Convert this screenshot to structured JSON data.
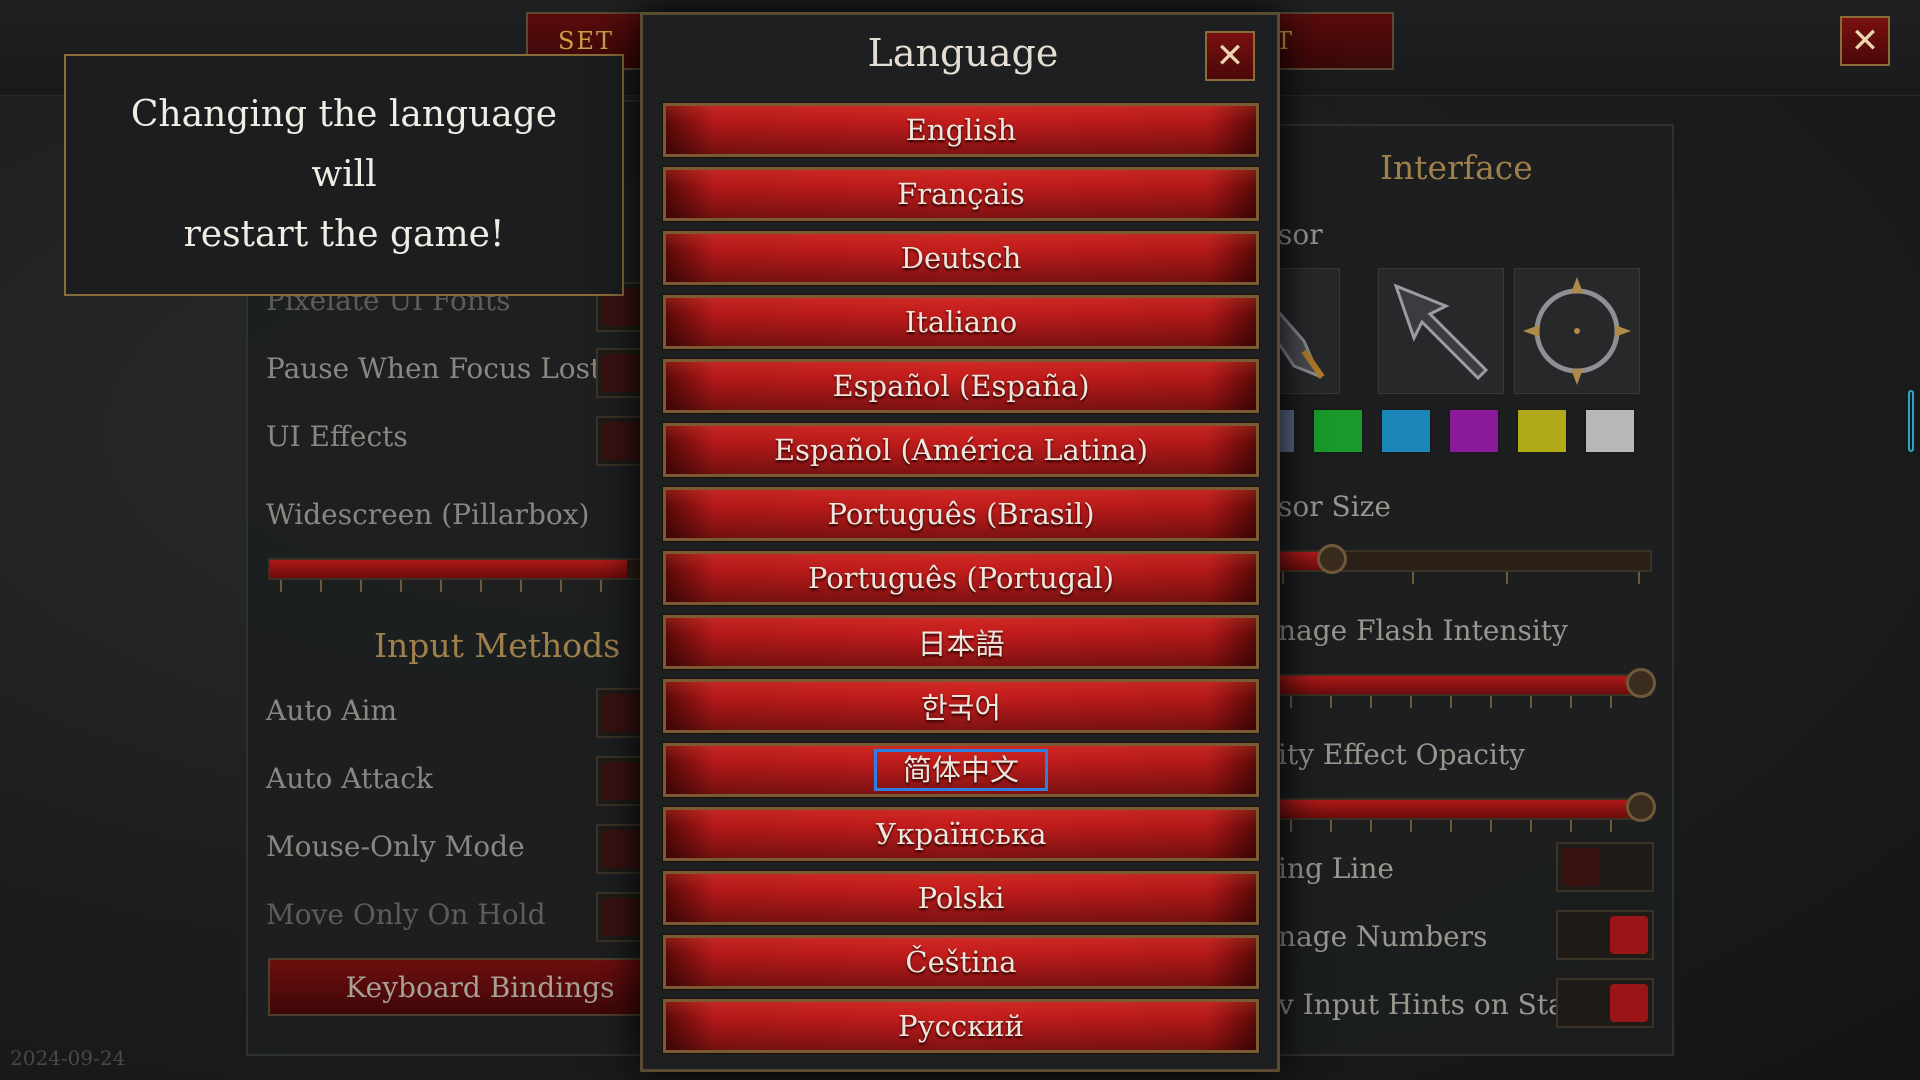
{
  "settings": {
    "tab_left_label": "SET",
    "tab_right_label": "T"
  },
  "notice": {
    "text_line1": "Changing the language will",
    "text_line2": "restart the game!"
  },
  "left_panel": {
    "items": [
      {
        "label": "Pixelate UI Fonts",
        "state": "off"
      },
      {
        "label": "Pause When Focus Lost",
        "state": "off"
      },
      {
        "label": "UI Effects",
        "state": "off"
      }
    ],
    "widescreen_label": "Widescreen (Pillarbox)",
    "widescreen_value": 0.95,
    "input_methods_heading": "Input Methods",
    "input_items": [
      {
        "label": "Auto Aim",
        "state": "off"
      },
      {
        "label": "Auto Attack",
        "state": "off"
      },
      {
        "label": "Mouse-Only Mode",
        "state": "off"
      },
      {
        "label": "Move Only On Hold",
        "state": "off"
      }
    ],
    "keyboard_bindings_label": "Keyboard Bindings"
  },
  "right_panel": {
    "heading": "Interface",
    "cursor_label": "sor",
    "cursor_size_label": "sor Size",
    "cursor_size_value": 0.2,
    "flash_label": "nage Flash Intensity",
    "flash_value": 1.0,
    "opacity_label": "ity Effect Opacity",
    "opacity_value": 1.0,
    "aiming_line_label": "ing Line",
    "aiming_line_state": "off",
    "damage_numbers_label": "nage Numbers",
    "damage_numbers_state": "on",
    "input_hints_label": "v Input Hints on Start",
    "input_hints_state": "on",
    "cursor_icons": [
      "gauntlet-cursor-icon",
      "arrow-cursor-icon",
      "crosshair-cursor-icon"
    ],
    "colors": [
      "#5c6a8a",
      "#1a9a2a",
      "#1b86b8",
      "#8a1a9a",
      "#b0aa18",
      "#b8b8b8"
    ]
  },
  "language_modal": {
    "title": "Language",
    "close_icon": "close-icon",
    "languages": [
      "English",
      "Français",
      "Deutsch",
      "Italiano",
      "Español (España)",
      "Español (América Latina)",
      "Português (Brasil)",
      "Português (Portugal)",
      "日本語",
      "한국어",
      "简体中文",
      "Українська",
      "Polski",
      "Čeština",
      "Русский"
    ],
    "selected_index": 10
  },
  "date_stamp": "2024-09-24"
}
